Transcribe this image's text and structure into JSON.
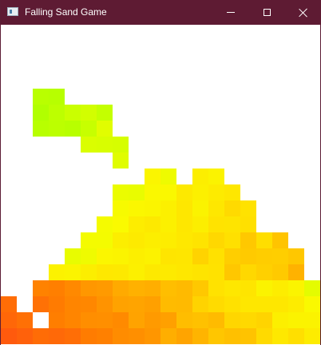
{
  "window": {
    "title": "Falling Sand Game",
    "icon": "app-window-icon",
    "controls": {
      "minimize": "minimize-icon",
      "maximize": "maximize-icon",
      "close": "close-icon"
    }
  },
  "colors": {
    "titlebar": "#5e1b33",
    "canvas_background": "#ffffff",
    "sand_hues": [
      "#ff5a10",
      "#ff7a00",
      "#ff9a00",
      "#ffbf00",
      "#ffe000",
      "#ffff00",
      "#e6ff00",
      "#c8ff00",
      "#a6ff00"
    ]
  }
}
